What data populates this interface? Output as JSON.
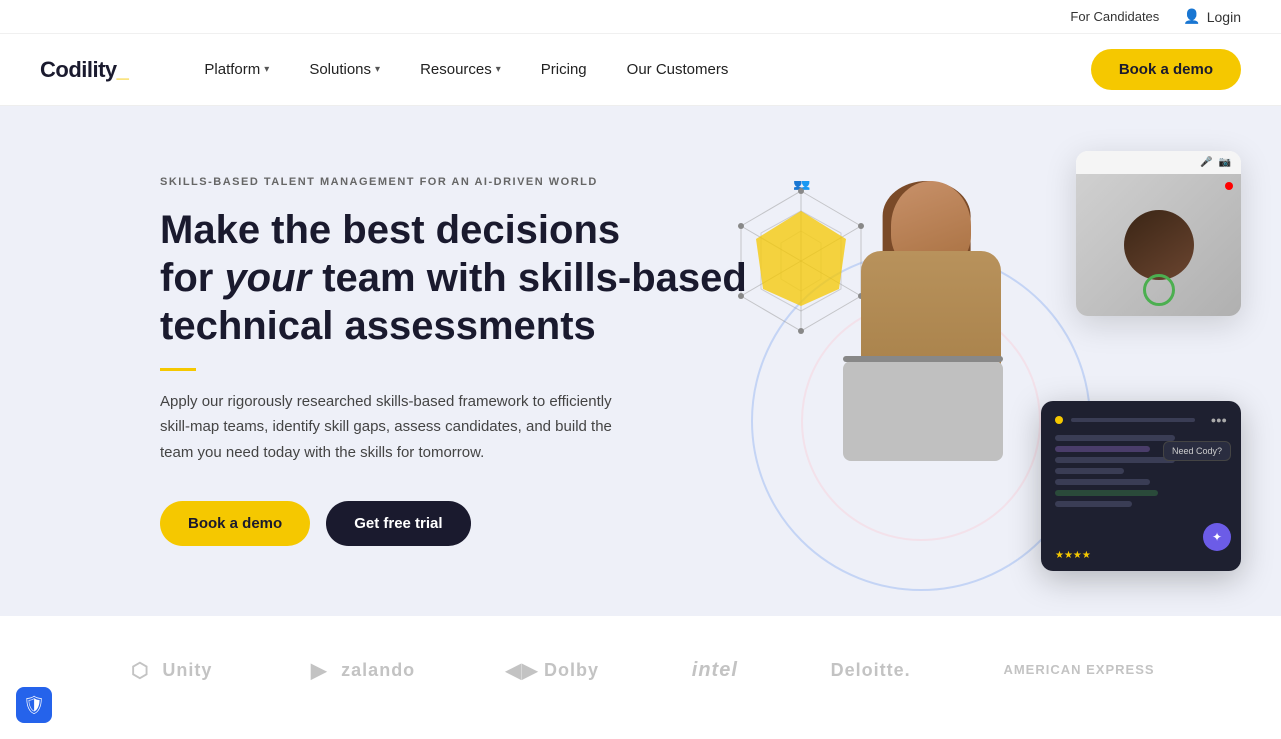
{
  "topbar": {
    "candidates_label": "For Candidates",
    "login_label": "Login"
  },
  "navbar": {
    "logo": "Codility",
    "logo_underscore": "_",
    "nav_items": [
      {
        "label": "Platform",
        "has_dropdown": true
      },
      {
        "label": "Solutions",
        "has_dropdown": true
      },
      {
        "label": "Resources",
        "has_dropdown": true
      },
      {
        "label": "Pricing",
        "has_dropdown": false
      },
      {
        "label": "Our Customers",
        "has_dropdown": false
      }
    ],
    "book_demo_label": "Book a demo"
  },
  "hero": {
    "eyebrow": "SKILLS-BASED TALENT MANAGEMENT FOR AN AI-DRIVEN WORLD",
    "title_line1": "Make the best decisions",
    "title_line2": "for ",
    "title_italic": "your",
    "title_line2_rest": " team with skills-based",
    "title_line3": "technical assessments",
    "description": "Apply our rigorously researched skills-based framework to efficiently skill-map teams, identify skill gaps, assess candidates, and build the team you need today with the skills for tomorrow.",
    "btn_demo": "Book a demo",
    "btn_trial": "Get free trial"
  },
  "customers_bar": {
    "logos": [
      {
        "name": "Unity",
        "icon": "⬡"
      },
      {
        "name": "zalando",
        "icon": "▶"
      },
      {
        "name": "Dolby",
        "icon": "◼◼"
      },
      {
        "name": "intel",
        "icon": ""
      },
      {
        "name": "Deloitte.",
        "icon": ""
      },
      {
        "name": "AMERICAN EXPRESS",
        "icon": ""
      }
    ]
  },
  "security_badge": {
    "icon": "🛡"
  },
  "video_card": {
    "mic_icon": "🎤",
    "cam_icon": "📷"
  },
  "code_card": {
    "badge_text": "Need Cody?",
    "stars_text": "★★★★",
    "ai_icon": "✦"
  }
}
